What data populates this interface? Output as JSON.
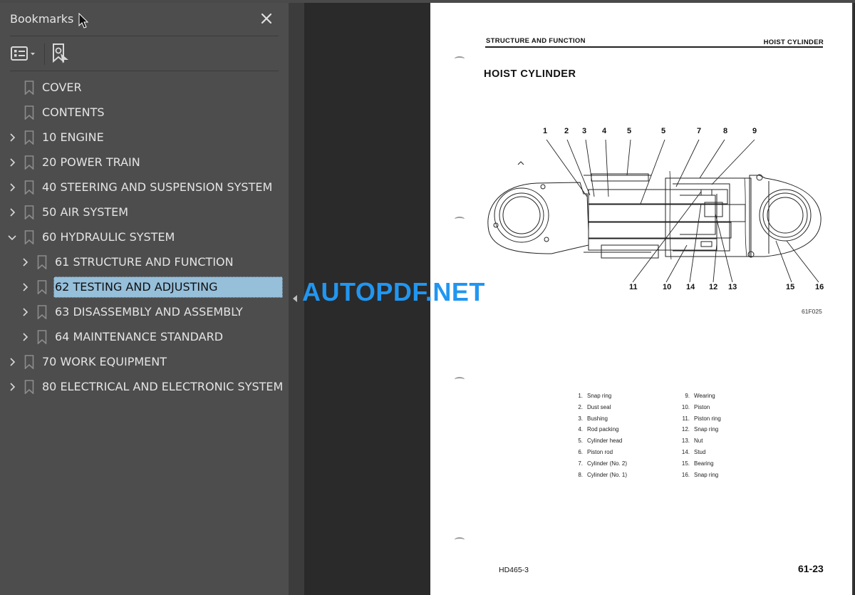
{
  "panel": {
    "title": "Bookmarks",
    "close_icon": "close-icon",
    "toolbar": {
      "options_icon": "list-options-icon",
      "options_dropdown_icon": "chevron-down-icon",
      "find_bookmark_icon": "find-current-bookmark-icon"
    }
  },
  "bookmarks": [
    {
      "label": "COVER",
      "level": 0,
      "expandable": false
    },
    {
      "label": "CONTENTS",
      "level": 0,
      "expandable": false
    },
    {
      "label": "10 ENGINE",
      "level": 0,
      "expandable": true,
      "expanded": false
    },
    {
      "label": "20 POWER TRAIN",
      "level": 0,
      "expandable": true,
      "expanded": false
    },
    {
      "label": "40 STEERING AND SUSPENSION SYSTEM",
      "level": 0,
      "expandable": true,
      "expanded": false
    },
    {
      "label": "50 AIR SYSTEM",
      "level": 0,
      "expandable": true,
      "expanded": false
    },
    {
      "label": "60 HYDRAULIC SYSTEM",
      "level": 0,
      "expandable": true,
      "expanded": true
    },
    {
      "label": "61 STRUCTURE AND FUNCTION",
      "level": 1,
      "expandable": true,
      "expanded": false
    },
    {
      "label": "62 TESTING AND ADJUSTING",
      "level": 1,
      "expandable": true,
      "expanded": false,
      "selected": true
    },
    {
      "label": "63 DISASSEMBLY AND ASSEMBLY",
      "level": 1,
      "expandable": true,
      "expanded": false
    },
    {
      "label": "64 MAINTENANCE STANDARD",
      "level": 1,
      "expandable": true,
      "expanded": false
    },
    {
      "label": "70 WORK EQUIPMENT",
      "level": 0,
      "expandable": true,
      "expanded": false
    },
    {
      "label": "80 ELECTRICAL AND ELECTRONIC SYSTEM",
      "level": 0,
      "expandable": true,
      "expanded": false
    }
  ],
  "watermark": {
    "text": "AUTOPDF.NET",
    "color": "#2196f0"
  },
  "page": {
    "header_left": "STRUCTURE AND FUNCTION",
    "header_right": "HOIST CYLINDER",
    "title": "HOIST CYLINDER",
    "figure_code": "61F025",
    "callouts_top": [
      "1",
      "2",
      "3",
      "4",
      "5",
      "5",
      "7",
      "8",
      "9"
    ],
    "callouts_bottom": [
      "11",
      "10",
      "14",
      "12",
      "13",
      "15",
      "16"
    ],
    "parts_left": [
      {
        "num": "1.",
        "name": "Snap ring"
      },
      {
        "num": "2.",
        "name": "Dust seal"
      },
      {
        "num": "3.",
        "name": "Bushing"
      },
      {
        "num": "4.",
        "name": "Rod packing"
      },
      {
        "num": "5.",
        "name": "Cylinder head"
      },
      {
        "num": "6.",
        "name": "Piston rod"
      },
      {
        "num": "7.",
        "name": "Cylinder (No. 2)"
      },
      {
        "num": "8.",
        "name": "Cylinder (No. 1)"
      }
    ],
    "parts_right": [
      {
        "num": "9.",
        "name": "Wearing"
      },
      {
        "num": "10.",
        "name": "Piston"
      },
      {
        "num": "11.",
        "name": "Piston ring"
      },
      {
        "num": "12.",
        "name": "Snap ring"
      },
      {
        "num": "13.",
        "name": "Nut"
      },
      {
        "num": "14.",
        "name": "Stud"
      },
      {
        "num": "15.",
        "name": "Bearing"
      },
      {
        "num": "16.",
        "name": "Snap ring"
      }
    ],
    "footer_model": "HD465-3",
    "footer_page": "61-23"
  },
  "colors": {
    "panel_bg": "#4d4d4d",
    "viewer_bg": "#2a2a2a",
    "selection_bg": "#96bfda"
  }
}
